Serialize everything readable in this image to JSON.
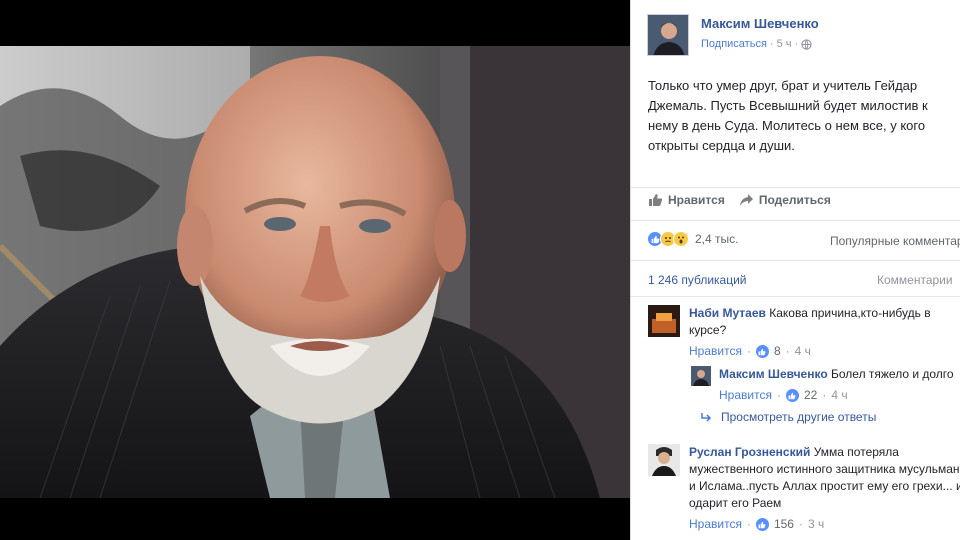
{
  "post": {
    "author": "Максим Шевченко",
    "subscribe": "Подписаться",
    "time": "5 ч",
    "text": "Только что умер друг, брат и учитель Гейдар\nДжемаль. Пусть Всевышний будет милостив к\nнему в день Суда. Молитесь о нем все, у кого\nоткрыты сердца и души."
  },
  "actions": {
    "like": "Нравится",
    "share": "Поделиться"
  },
  "reactions": {
    "count": "2,4 тыс.",
    "popular": "Популярные комментарии"
  },
  "stats": {
    "shares": "1 246 публикаций",
    "comments": "Комментарии"
  },
  "comments": [
    {
      "name": "Наби Мутаев",
      "text": "Какова причина,кто-нибудь в курсе?",
      "like": "Нравится",
      "likes": "8",
      "time": "4 ч"
    },
    {
      "name": "Максим Шевченко",
      "text": "Болел тяжело и долго",
      "like": "Нравится",
      "likes": "22",
      "time": "4 ч"
    },
    {
      "name": "Руслан Грозненский",
      "text": "Умма потеряла мужественного истинного защитника мусульман и Ислама..пусть Аллах простит ему его грехи... и одарит его Раем",
      "like": "Нравится",
      "likes": "156",
      "time": "3 ч"
    }
  ],
  "more_replies": "Просмотреть другие ответы",
  "colors": {
    "link": "#365899",
    "like_blue": "#5890ff",
    "panel_bg": "#ffffff"
  }
}
